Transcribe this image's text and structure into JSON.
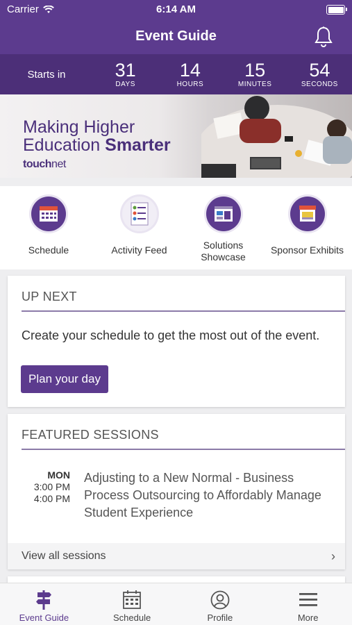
{
  "status_bar": {
    "carrier": "Carrier",
    "time": "6:14 AM"
  },
  "header": {
    "title": "Event Guide"
  },
  "countdown": {
    "label": "Starts in",
    "units": [
      {
        "value": "31",
        "label": "DAYS"
      },
      {
        "value": "14",
        "label": "HOURS"
      },
      {
        "value": "15",
        "label": "MINUTES"
      },
      {
        "value": "54",
        "label": "SECONDS"
      }
    ]
  },
  "banner": {
    "line1": "Making Higher",
    "line2_regular": "Education ",
    "line2_bold": "Smarter",
    "brand_bold": "touch",
    "brand_regular": "net"
  },
  "quick_links": [
    {
      "label": "Schedule",
      "icon": "calendar-icon"
    },
    {
      "label": "Activity Feed",
      "icon": "feed-icon"
    },
    {
      "label": "Solutions Showcase",
      "icon": "showcase-icon"
    },
    {
      "label": "Sponsor Exhibits",
      "icon": "storefront-icon"
    }
  ],
  "up_next": {
    "title": "UP NEXT",
    "message": "Create your schedule to get the most out of the event.",
    "button": "Plan your day"
  },
  "featured": {
    "title": "FEATURED SESSIONS",
    "session": {
      "day": "MON",
      "start": "3:00 PM",
      "end": "4:00 PM",
      "title": "Adjusting to a New Normal - Business Process Outsourcing to Affordably Manage Student Experience"
    },
    "view_all": "View all sessions"
  },
  "tabs": [
    {
      "label": "Event Guide",
      "icon": "signpost-icon",
      "active": true
    },
    {
      "label": "Schedule",
      "icon": "calendar-icon",
      "active": false
    },
    {
      "label": "Profile",
      "icon": "profile-icon",
      "active": false
    },
    {
      "label": "More",
      "icon": "menu-icon",
      "active": false
    }
  ],
  "colors": {
    "brand": "#5c3b8e",
    "countdown_bg": "#4c2f78"
  }
}
